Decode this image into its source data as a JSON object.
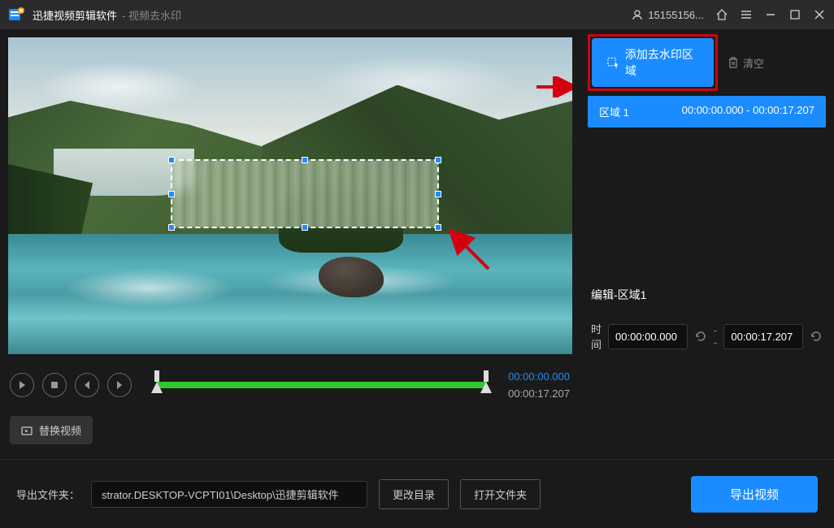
{
  "titlebar": {
    "app_name": "迅捷视频剪辑软件",
    "page_title": "- 视频去水印",
    "user_id": "15155156..."
  },
  "right_panel": {
    "add_button": "添加去水印区域",
    "clear_button": "清空",
    "region": {
      "name": "区域 1",
      "time_range": "00:00:00.000 - 00:00:17.207"
    },
    "edit_title": "编辑-区域1",
    "time_label": "时间",
    "time_start": "00:00:00.000",
    "time_end": "00:00:17.207"
  },
  "playback": {
    "current_time": "00:00:00.000",
    "total_time": "00:00:17.207"
  },
  "replace_video": "替换视频",
  "bottom": {
    "export_folder_label": "导出文件夹：",
    "path": "strator.DESKTOP-VCPTI01\\Desktop\\迅捷剪辑软件",
    "change_dir": "更改目录",
    "open_folder": "打开文件夹",
    "export": "导出视频"
  }
}
